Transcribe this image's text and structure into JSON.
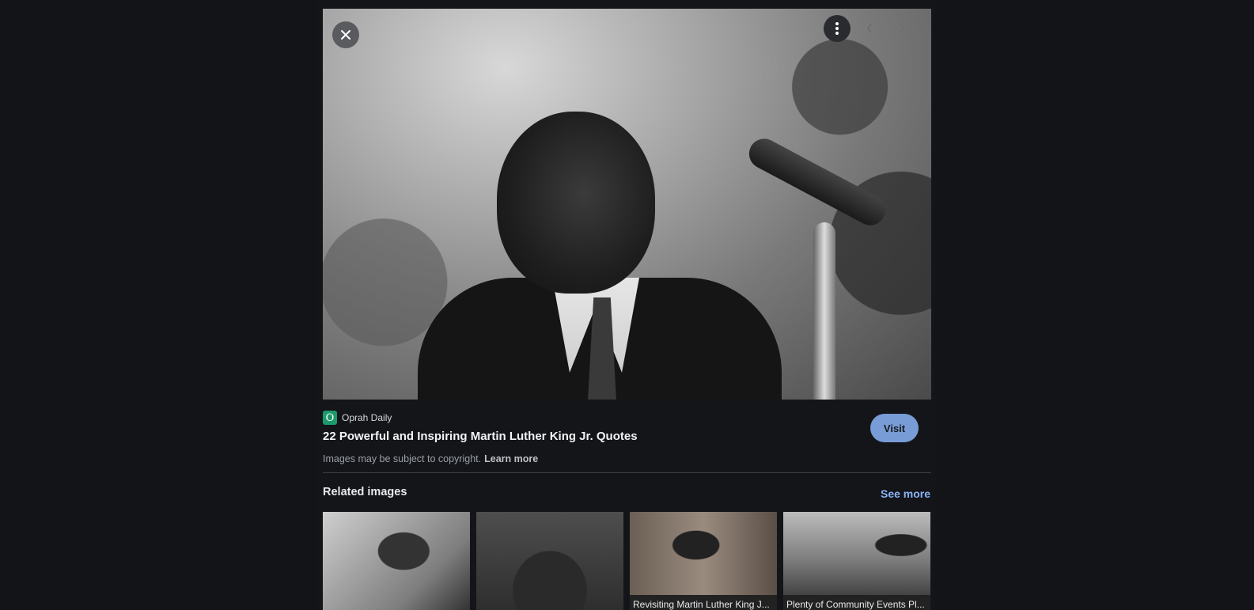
{
  "viewer": {
    "close_icon": "close-icon",
    "more_icon": "more-vertical-icon",
    "prev_icon": "chevron-left-icon",
    "next_icon": "chevron-right-icon"
  },
  "result": {
    "source_name": "Oprah Daily",
    "favicon_letter": "O",
    "favicon_color": "#1c9a6b",
    "title": "22 Powerful and Inspiring Martin Luther King Jr. Quotes",
    "visit_label": "Visit",
    "copyright_text": "Images may be subject to copyright.",
    "learn_more_label": "Learn more"
  },
  "related": {
    "heading": "Related images",
    "see_more_label": "See more",
    "items": [
      {
        "caption": ""
      },
      {
        "caption": ""
      },
      {
        "caption": "Revisiting Martin Luther King J..."
      },
      {
        "caption": "Plenty of Community Events Pl..."
      }
    ]
  },
  "colors": {
    "background": "#131417",
    "accent": "#8ab4f8"
  }
}
